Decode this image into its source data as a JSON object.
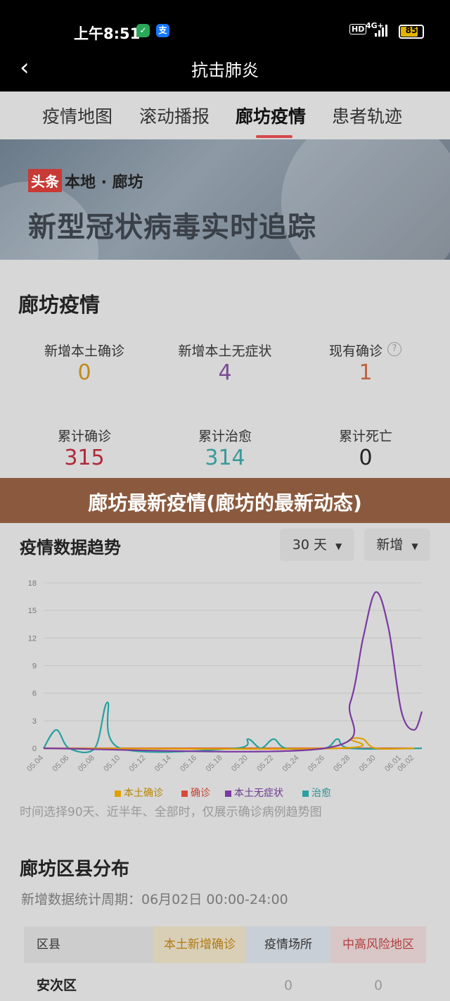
{
  "status_bar": {
    "time": "上午8:51",
    "network": "4G+",
    "hd": "HD",
    "battery": "85",
    "battery_level": 0.85
  },
  "nav": {
    "back_icon": "chevron-left-icon",
    "title": "抗击肺炎"
  },
  "tabs": [
    {
      "label": "疫情地图",
      "active": false
    },
    {
      "label": "滚动播报",
      "active": false
    },
    {
      "label": "廊坊疫情",
      "active": true
    },
    {
      "label": "患者轨迹",
      "active": false
    }
  ],
  "banner": {
    "tag": "头条",
    "location": "本地 · 廊坊",
    "title": "新型冠状病毒实时追踪"
  },
  "summary": {
    "title": "廊坊疫情",
    "stats": [
      {
        "label": "新增本土确诊",
        "value": "0",
        "color": "#c08a1a"
      },
      {
        "label": "新增本土无症状",
        "value": "4",
        "color": "#7a4a95"
      },
      {
        "label": "现有确诊",
        "value": "1",
        "color": "#c0623a"
      },
      {
        "label": "累计确诊",
        "value": "315",
        "color": "#b02a3a"
      },
      {
        "label": "累计治愈",
        "value": "314",
        "color": "#3a9a9a"
      },
      {
        "label": "累计死亡",
        "value": "0",
        "color": "#222222"
      }
    ],
    "partial_text": "新增"
  },
  "overlay": {
    "text": "廊坊最新疫情(廊坊的最新动态)"
  },
  "trend": {
    "title": "疫情数据趋势",
    "range_select": "30 天",
    "type_select": "新增",
    "note": "时间选择90天、近半年、全部时，仅展示确诊病例趋势图"
  },
  "chart_data": {
    "type": "line",
    "x": [
      "05.04",
      "05.06",
      "05.08",
      "05.10",
      "05.12",
      "05.14",
      "05.16",
      "05.18",
      "05.20",
      "05.22",
      "05.24",
      "05.26",
      "05.28",
      "05.30",
      "06.01",
      "06.02"
    ],
    "yticks": [
      0,
      3,
      6,
      9,
      12,
      15,
      18
    ],
    "ylim": [
      0,
      18
    ],
    "grid": true,
    "legend_position": "bottom",
    "series": [
      {
        "name": "本土确诊",
        "color": "#e0a000",
        "points": [
          [
            0,
            0
          ],
          [
            23,
            0
          ],
          [
            24,
            1
          ],
          [
            25,
            1
          ],
          [
            26,
            0
          ],
          [
            29,
            0
          ]
        ]
      },
      {
        "name": "确诊",
        "color": "#d84a3a",
        "points": [
          [
            0,
            0
          ],
          [
            29,
            0
          ]
        ]
      },
      {
        "name": "本土无症状",
        "color": "#7a3aa0",
        "points": [
          [
            0,
            0
          ],
          [
            22,
            0
          ],
          [
            24,
            5
          ],
          [
            25,
            12
          ],
          [
            26,
            17
          ],
          [
            27,
            13
          ],
          [
            28,
            4
          ],
          [
            29,
            2
          ],
          [
            29.6,
            4
          ]
        ]
      },
      {
        "name": "治愈",
        "color": "#2aa0a0",
        "points": [
          [
            0,
            0
          ],
          [
            1,
            2
          ],
          [
            2,
            0
          ],
          [
            4,
            0
          ],
          [
            5,
            5
          ],
          [
            6,
            0
          ],
          [
            15,
            0
          ],
          [
            16,
            1
          ],
          [
            17,
            0
          ],
          [
            18,
            1
          ],
          [
            19,
            0
          ],
          [
            22,
            0
          ],
          [
            23,
            1
          ],
          [
            24,
            0
          ],
          [
            29.6,
            0
          ]
        ]
      }
    ]
  },
  "district": {
    "title": "廊坊区县分布",
    "subtitle": "新增数据统计周期：06月02日 00:00-24:00",
    "headers": [
      "区县",
      "本土新增确诊",
      "疫情场所",
      "中高风险地区"
    ],
    "rows": [
      {
        "name": "安次区",
        "confirmed": "",
        "places": "0",
        "risk": "0"
      }
    ]
  }
}
